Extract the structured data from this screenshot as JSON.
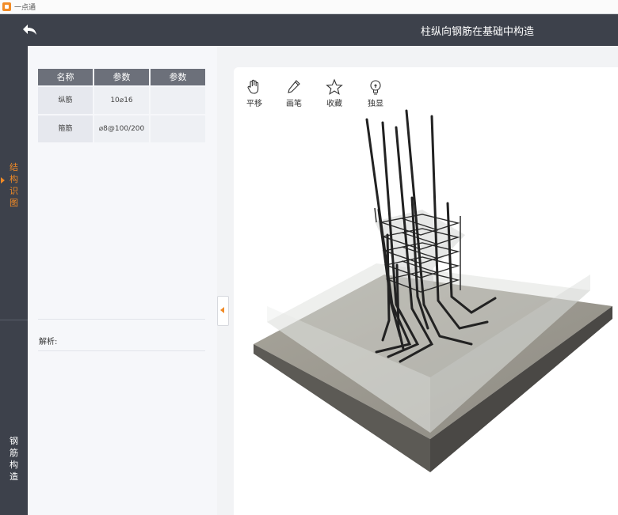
{
  "app": {
    "name": "一点通"
  },
  "header": {
    "title": "柱纵向钢筋在基础中构造"
  },
  "sidenav": {
    "items": [
      {
        "label": "结构识图",
        "active": true
      },
      {
        "label": "钢筋构造",
        "active": false
      }
    ]
  },
  "table": {
    "headers": [
      "名称",
      "参数",
      "参数"
    ],
    "rows": [
      {
        "name": "纵筋",
        "param1": "10⌀16",
        "param2": ""
      },
      {
        "name": "箍筋",
        "param1": "⌀8@100/200",
        "param2": ""
      }
    ]
  },
  "analysis": {
    "label": "解析:"
  },
  "toolbar": {
    "items": [
      {
        "label": "平移",
        "icon": "hand-icon"
      },
      {
        "label": "画笔",
        "icon": "pencil-icon"
      },
      {
        "label": "收藏",
        "icon": "star-icon"
      },
      {
        "label": "独显",
        "icon": "lightbulb-icon"
      }
    ]
  },
  "colors": {
    "accent": "#f08a26",
    "header": "#3d414b",
    "table_header": "#6c707a"
  }
}
